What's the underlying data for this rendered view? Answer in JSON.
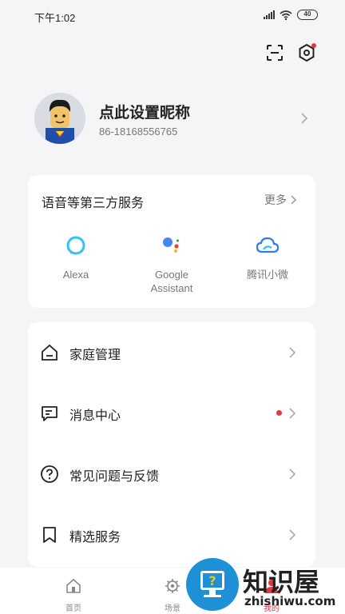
{
  "status_bar": {
    "time": "下午1:02",
    "battery": "40"
  },
  "header": {
    "scan_icon": "scan-icon",
    "device_icon": "hexagon-settings-icon"
  },
  "profile": {
    "nickname": "点此设置昵称",
    "phone": "86-18168556765"
  },
  "voice_services": {
    "title": "语音等第三方服务",
    "more": "更多",
    "items": [
      {
        "label": "Alexa",
        "icon": "alexa-icon"
      },
      {
        "label": "Google\nAssistant",
        "icon": "google-assistant-icon"
      },
      {
        "label": "腾讯小微",
        "icon": "tencent-xiaowei-icon"
      }
    ]
  },
  "menu": {
    "items": [
      {
        "label": "家庭管理",
        "icon": "home-icon"
      },
      {
        "label": "消息中心",
        "icon": "message-icon",
        "has_dot": true
      },
      {
        "label": "常见问题与反馈",
        "icon": "question-icon"
      },
      {
        "label": "精选服务",
        "icon": "bookmark-icon"
      }
    ]
  },
  "tabbar": {
    "items": [
      {
        "label": "首页",
        "icon": "home-tab-icon"
      },
      {
        "label": "场景",
        "icon": "gear-tab-icon"
      },
      {
        "label": "我的",
        "icon": "user-tab-icon",
        "active": true
      }
    ]
  },
  "watermark": {
    "title": "知识屋",
    "site": "zhishiwu.com"
  },
  "colors": {
    "accent": "#e5383b",
    "alexa": "#31c4f3",
    "tencent": "#2f7df6"
  }
}
